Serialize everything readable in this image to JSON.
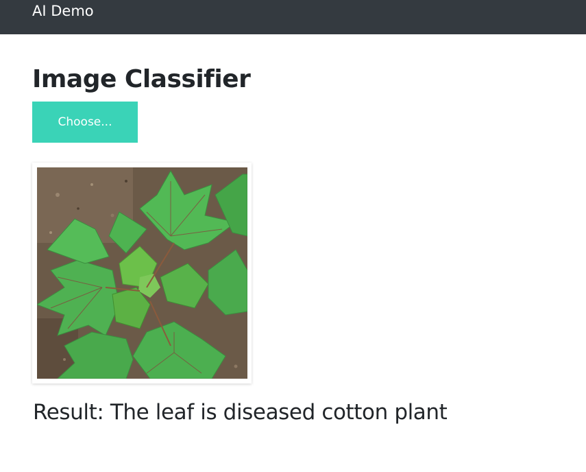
{
  "navbar": {
    "brand": "AI Demo",
    "background": "#343a40"
  },
  "main": {
    "title": "Image Classifier",
    "choose_button": {
      "label": "Choose...",
      "color": "#3ad3b7"
    },
    "preview_image": {
      "subject": "cotton-plant-leaf-photo"
    },
    "result_text": "Result: The leaf is diseased cotton plant"
  }
}
